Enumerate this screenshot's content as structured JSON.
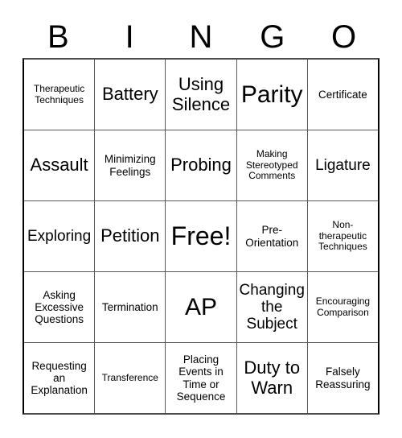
{
  "card": {
    "header_letters": [
      "B",
      "I",
      "N",
      "G",
      "O"
    ],
    "rows": [
      [
        {
          "text": "Therapeutic Techniques",
          "size": "sz-xs"
        },
        {
          "text": "Battery",
          "size": "sz-xl"
        },
        {
          "text": "Using Silence",
          "size": "sz-xl"
        },
        {
          "text": "Parity",
          "size": "sz-xxl"
        },
        {
          "text": "Certificate",
          "size": "sz-s"
        }
      ],
      [
        {
          "text": "Assault",
          "size": "sz-xl"
        },
        {
          "text": "Minimizing Feelings",
          "size": "sz-s"
        },
        {
          "text": "Probing",
          "size": "sz-xl"
        },
        {
          "text": "Making Stereotyped Comments",
          "size": "sz-xs"
        },
        {
          "text": "Ligature",
          "size": "sz-l"
        }
      ],
      [
        {
          "text": "Exploring",
          "size": "sz-l"
        },
        {
          "text": "Petition",
          "size": "sz-xl"
        },
        {
          "text": "Free!",
          "size": "sz-free"
        },
        {
          "text": "Pre-Orientation",
          "size": "sz-s"
        },
        {
          "text": "Non-therapeutic Techniques",
          "size": "sz-xs"
        }
      ],
      [
        {
          "text": "Asking Excessive Questions",
          "size": "sz-s"
        },
        {
          "text": "Termination",
          "size": "sz-s"
        },
        {
          "text": "AP",
          "size": "sz-xxl"
        },
        {
          "text": "Changing the Subject",
          "size": "sz-l"
        },
        {
          "text": "Encouraging Comparison",
          "size": "sz-xs"
        }
      ],
      [
        {
          "text": "Requesting an Explanation",
          "size": "sz-s"
        },
        {
          "text": "Transference",
          "size": "sz-xs"
        },
        {
          "text": "Placing Events in Time or Sequence",
          "size": "sz-s"
        },
        {
          "text": "Duty to Warn",
          "size": "sz-xl"
        },
        {
          "text": "Falsely Reassuring",
          "size": "sz-s"
        }
      ]
    ]
  },
  "colors": {
    "border": "#595959",
    "outer_border": "#000000",
    "text": "#000000",
    "background": "#ffffff"
  }
}
